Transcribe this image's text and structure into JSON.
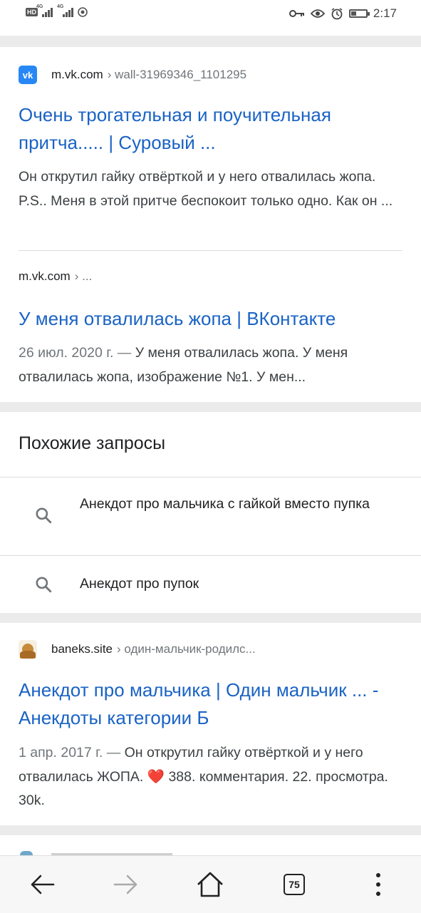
{
  "status_bar": {
    "hd": "HD",
    "net1": "4G",
    "net2": "4G",
    "time": "2:17",
    "battery_level": 0.3
  },
  "results": [
    {
      "domain": "m.vk.com",
      "crumb": "› wall-31969346_1101295",
      "title": "Очень трогательная и поучительная притча..... | Суровый ...",
      "snippet": "Он открутил гайку отвёрткой и у него отвалилась жопа. P.S.. Меня в этой притче беспокоит только одно. Как он ...",
      "favicon": "vk-icon"
    },
    {
      "domain": "m.vk.com",
      "crumb": "› ...",
      "title": "У меня отвалилась жопа | ВКонтакте",
      "date": "26 июл. 2020 г. —",
      "snippet": " У меня отвалилась жопа. У меня отвалилась жопа, изображение №1. У мен..."
    }
  ],
  "related": {
    "heading": "Похожие запросы",
    "items": [
      "Анекдот про мальчика с гайкой вместо пупка",
      "Анекдот про пупок"
    ]
  },
  "result3": {
    "domain": "baneks.site",
    "crumb": "› один-мальчик-родилс...",
    "title": "Анекдот про мальчика | Один мальчик ... - Анекдоты категории Б",
    "date": "1 апр. 2017 г. —",
    "snippet_a": " Он открутил гайку отвёрткой и у него отвалилась ЖОПА. ",
    "heart": "❤️",
    "snippet_b": " 388. комментария. 22. просмотра. 30k.",
    "favicon": "doge-icon"
  },
  "bottom_bar": {
    "tab_count": "75"
  },
  "colors": {
    "link": "#1a63c5",
    "separator": "#ebebeb"
  }
}
